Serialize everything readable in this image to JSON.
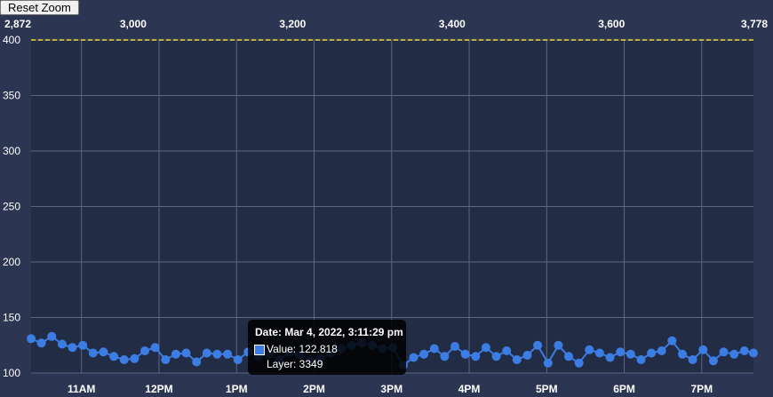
{
  "toolbar": {
    "reset_zoom_label": "Reset Zoom"
  },
  "colors": {
    "background": "#2c3551",
    "plot_background": "#222c45",
    "grid": "#5d6782",
    "series": "#3c7de3",
    "limit_line": "#f2d930",
    "text": "#ffffff"
  },
  "chart_data": {
    "type": "line",
    "title": "",
    "xlabel": "",
    "ylabel": "",
    "grid": true,
    "ylim": [
      100,
      400
    ],
    "y_ticks": [
      "100",
      "150",
      "200",
      "250",
      "300",
      "350",
      "400"
    ],
    "limit_line_value": 400,
    "x_time_range": [
      "10:21",
      "19:40"
    ],
    "x_time_ticks": [
      {
        "time": "11:00",
        "label": "11AM"
      },
      {
        "time": "12:00",
        "label": "12PM"
      },
      {
        "time": "13:00",
        "label": "1PM"
      },
      {
        "time": "14:00",
        "label": "2PM"
      },
      {
        "time": "15:00",
        "label": "3PM"
      },
      {
        "time": "16:00",
        "label": "4PM"
      },
      {
        "time": "17:00",
        "label": "5PM"
      },
      {
        "time": "18:00",
        "label": "6PM"
      },
      {
        "time": "19:00",
        "label": "7PM"
      }
    ],
    "layer_range": [
      2872,
      3778
    ],
    "layer_ticks": [
      "2,872",
      "3,000",
      "3,200",
      "3,400",
      "3,600",
      "3,778"
    ],
    "series": [
      {
        "x": [
          "10:21",
          "10:29",
          "10:37",
          "10:45",
          "10:53",
          "11:01",
          "11:09",
          "11:17",
          "11:25",
          "11:33",
          "11:41",
          "11:49",
          "11:57",
          "12:05",
          "12:13",
          "12:21",
          "12:29",
          "12:37",
          "12:45",
          "12:53",
          "13:01",
          "13:09",
          "13:17",
          "13:25",
          "13:33",
          "13:41",
          "13:49",
          "13:57",
          "14:05",
          "14:13",
          "14:21",
          "14:29",
          "14:37",
          "14:45",
          "14:53",
          "15:01",
          "15:09",
          "15:17",
          "15:25",
          "15:33",
          "15:41",
          "15:49",
          "15:57",
          "16:05",
          "16:13",
          "16:21",
          "16:29",
          "16:37",
          "16:45",
          "16:53",
          "17:01",
          "17:09",
          "17:17",
          "17:25",
          "17:33",
          "17:41",
          "17:49",
          "17:57",
          "18:05",
          "18:13",
          "18:21",
          "18:29",
          "18:37",
          "18:45",
          "18:53",
          "19:01",
          "19:09",
          "19:17",
          "19:25",
          "19:33",
          "19:40"
        ],
        "values": [
          131,
          127,
          133,
          126,
          123,
          125,
          118,
          119,
          115,
          112,
          113,
          120,
          123,
          112,
          117,
          118,
          110,
          118,
          117,
          117,
          112,
          119,
          115,
          117,
          112,
          119,
          116,
          112,
          113,
          118,
          122,
          125,
          127,
          125,
          122,
          123,
          107,
          114,
          117,
          122,
          115,
          124,
          117,
          115,
          123,
          115,
          120,
          112,
          116,
          125,
          109,
          125,
          115,
          109,
          121,
          118,
          114,
          119,
          117,
          112,
          118,
          120,
          129,
          117,
          112,
          121,
          111,
          119,
          117,
          120,
          118
        ]
      }
    ]
  },
  "tooltip": {
    "title": "Date: Mar 4, 2022, 3:11:29 pm",
    "value_line": "Value: 122.818",
    "layer_line": "Layer: 3349"
  }
}
